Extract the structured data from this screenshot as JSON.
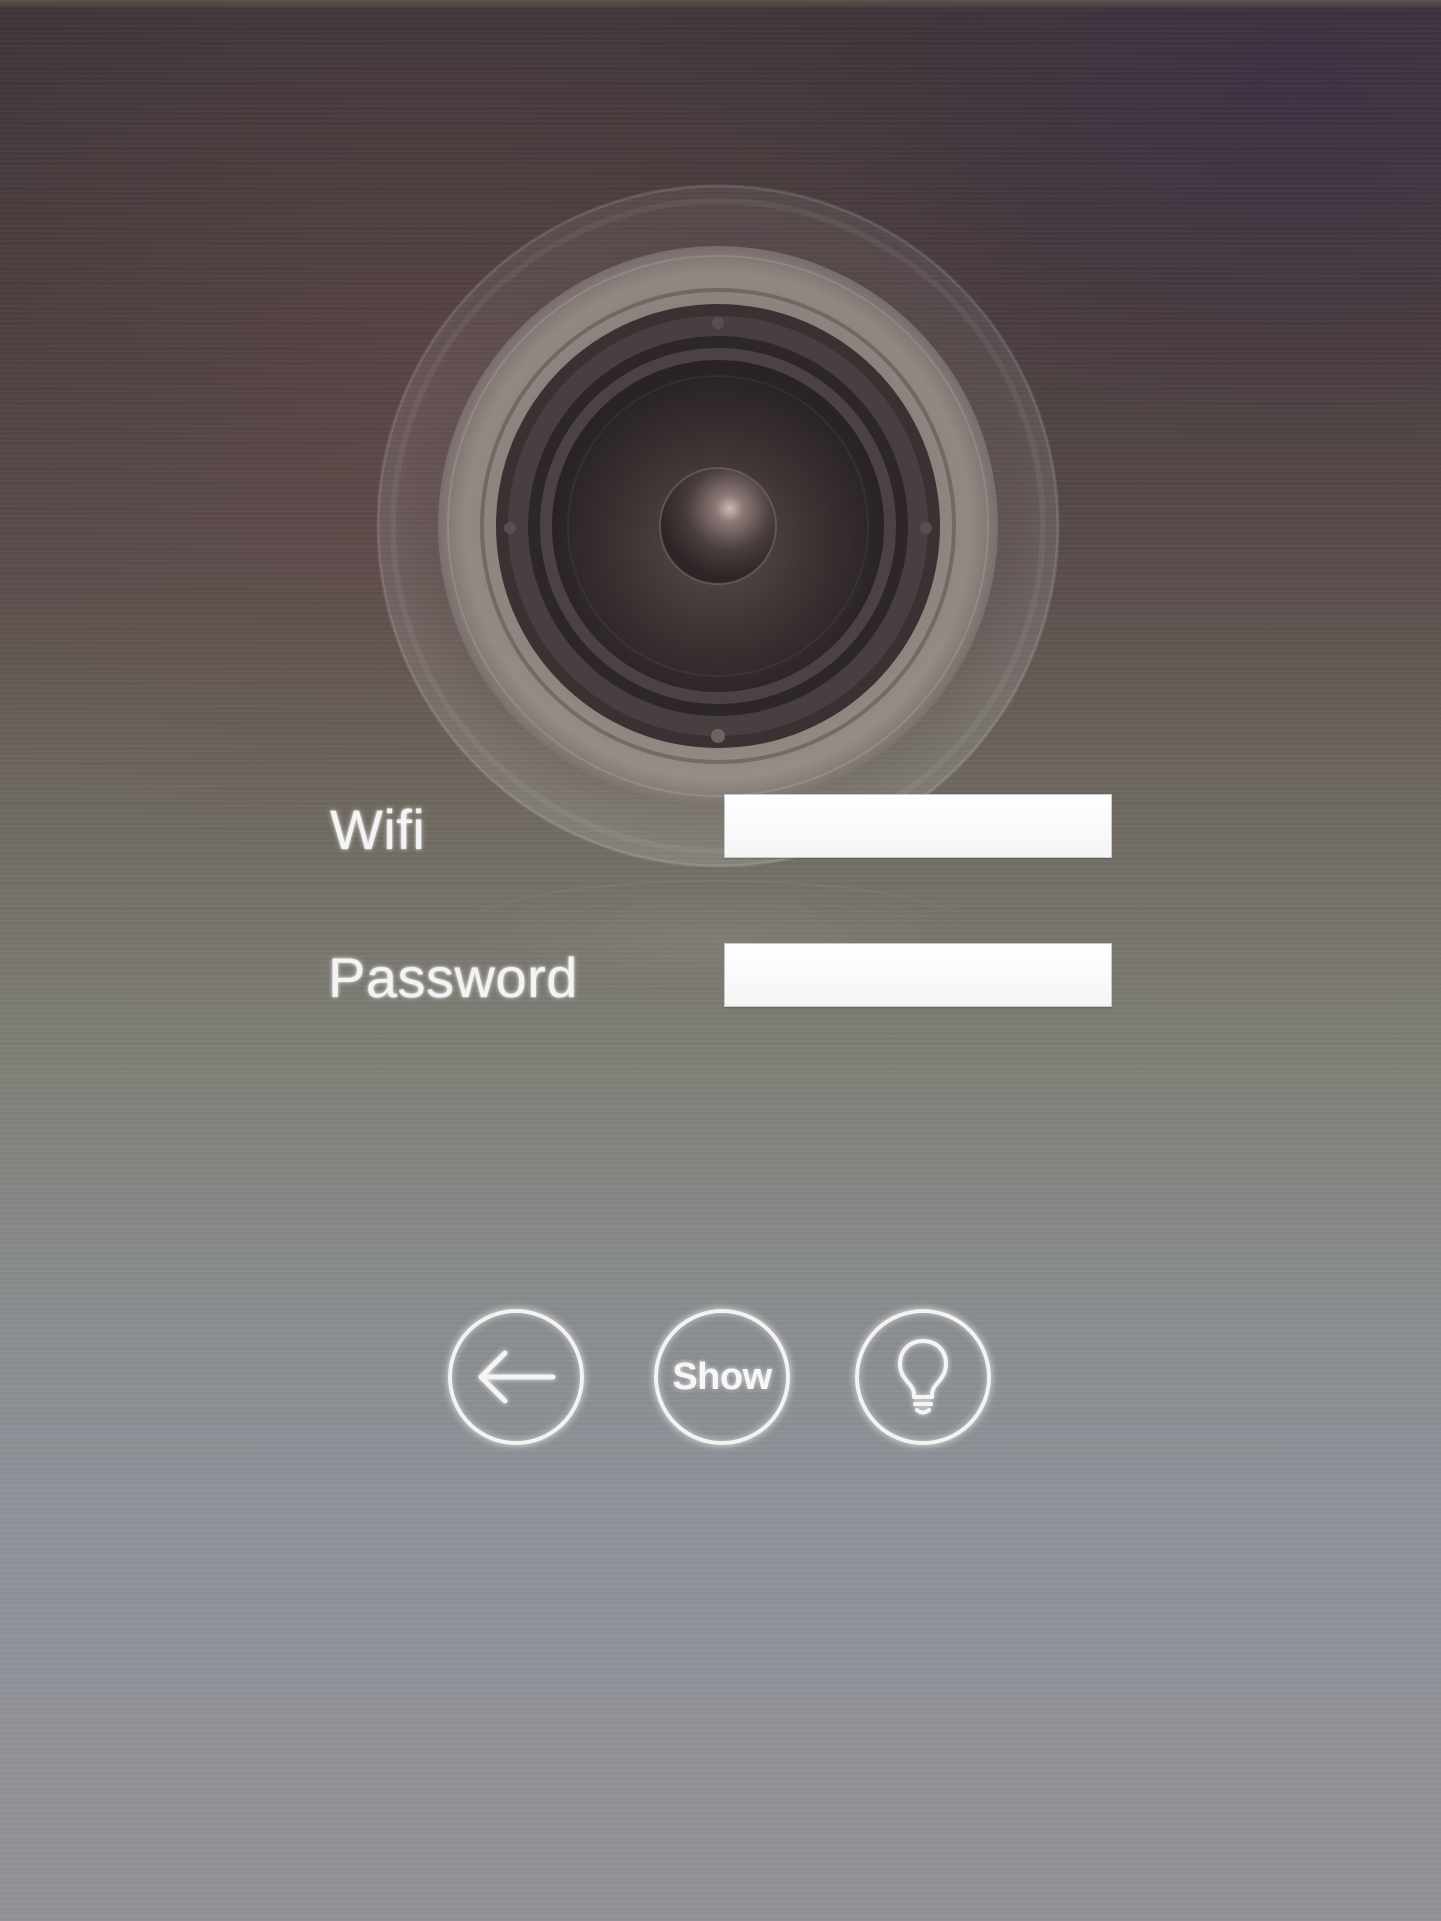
{
  "form": {
    "wifi_label": "Wifi",
    "wifi_value": "",
    "password_label": "Password",
    "password_value": ""
  },
  "buttons": {
    "back_icon": "arrow-left-icon",
    "show_label": "Show",
    "hint_icon": "lightbulb-icon"
  },
  "colors": {
    "input_background": "#ffffff",
    "label_text": "#f4f4f4",
    "button_ring": "#f3f3f3"
  }
}
